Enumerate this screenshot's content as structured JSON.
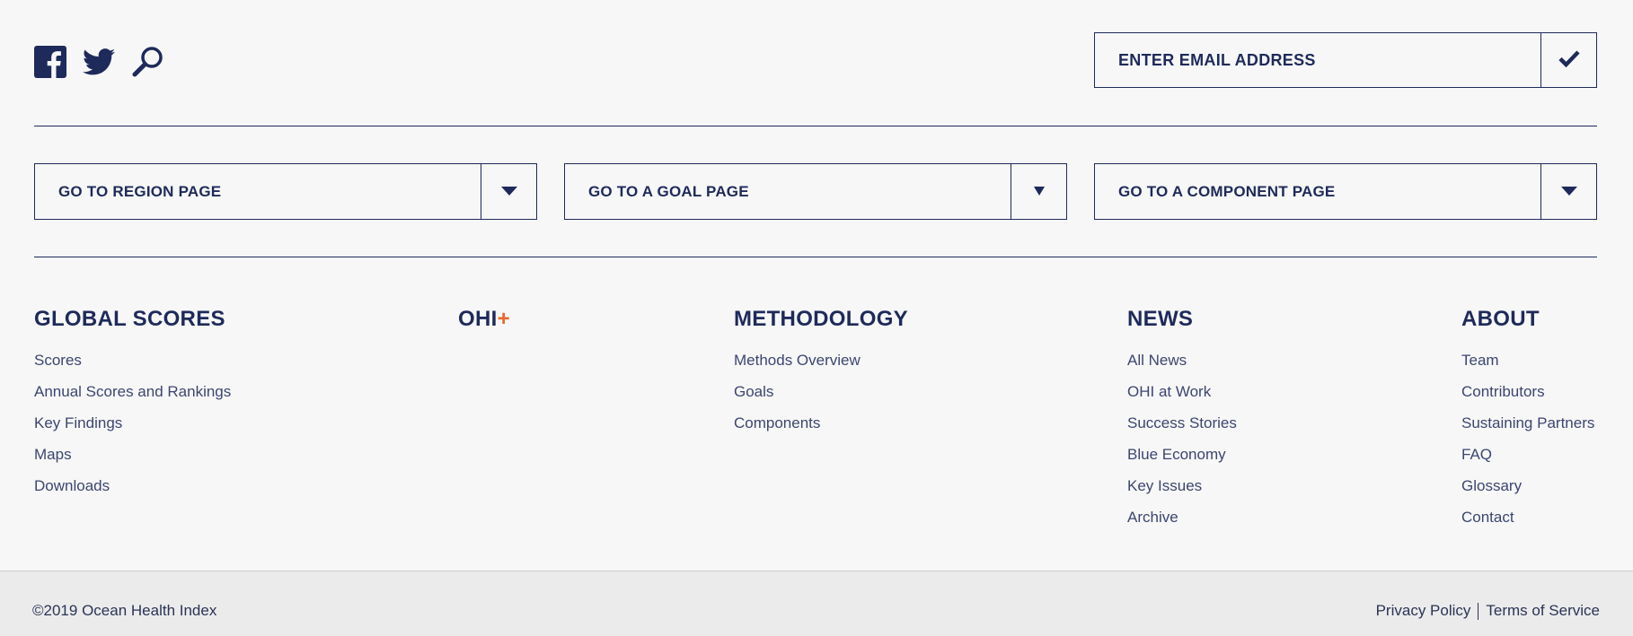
{
  "social": {
    "icons": [
      "facebook-icon",
      "twitter-icon",
      "search-icon"
    ]
  },
  "newsletter": {
    "placeholder": "ENTER EMAIL ADDRESS",
    "submit_icon": "checkmark-icon"
  },
  "dropdowns": [
    {
      "label": "GO TO REGION PAGE",
      "icon": "triangle-down-icon"
    },
    {
      "label": "GO TO A GOAL PAGE",
      "icon": "triangle-down-icon"
    },
    {
      "label": "GO TO A COMPONENT PAGE",
      "icon": "triangle-down-icon"
    }
  ],
  "columns": [
    {
      "title": "GLOBAL SCORES",
      "links": [
        "Scores",
        "Annual Scores and Rankings",
        "Key Findings",
        "Maps",
        "Downloads"
      ]
    },
    {
      "title": "OHI",
      "title_suffix": "+",
      "links": []
    },
    {
      "title": "METHODOLOGY",
      "links": [
        "Methods Overview",
        "Goals",
        "Components"
      ]
    },
    {
      "title": "NEWS",
      "links": [
        "All News",
        "OHI at Work",
        "Success Stories",
        "Blue Economy",
        "Key Issues",
        "Archive"
      ]
    },
    {
      "title": "ABOUT",
      "links": [
        "Team",
        "Contributors",
        "Sustaining Partners",
        "FAQ",
        "Glossary",
        "Contact"
      ]
    }
  ],
  "bottom": {
    "copyright": "©2019 Ocean Health Index",
    "privacy": "Privacy Policy",
    "terms": "Terms of Service"
  },
  "colors": {
    "navy": "#1e2a5a",
    "accent_orange": "#e8672a",
    "background": "#f7f7f7",
    "bottom_bar": "#ebebeb"
  }
}
